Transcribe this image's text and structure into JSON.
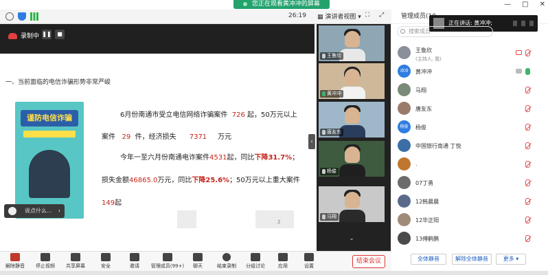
{
  "window": {
    "share_banner": "您正在观看黄冲冲的屏幕",
    "controls": [
      "—",
      "□",
      "✕"
    ]
  },
  "toolbar": {
    "time": "26:19",
    "view_mode": "演讲者视图",
    "members_header": "管理成员(10"
  },
  "recording": {
    "label": "录制中",
    "pause": "❚❚",
    "stop": "■"
  },
  "slide": {
    "section_title": "一、当前面临的电信诈骗形势非常严峻",
    "poster_title": "谨防电信诈骗",
    "line1_a": "6月份南通市受立电信网络诈骗案件",
    "line1_b": "726",
    "line1_c": "起，50万元以上",
    "line2_a": "案件",
    "line2_b": "29",
    "line2_c": "件，经济损失",
    "line2_d": "7371",
    "line2_e": "万元",
    "line3_a": "今年一至六月份南通电诈案件",
    "line3_b": "4531",
    "line3_c": "起，同比",
    "line3_d": "下降31.7%",
    "line3_e": "；",
    "line4_a": "损失金额",
    "line4_b": "46865.0",
    "line4_c": "万元，同比",
    "line4_d": "下降25.6%",
    "line4_e": "；50万元以上重大案件",
    "line5_a": "149",
    "line5_b": "起",
    "page_number": "2"
  },
  "chat_input": {
    "placeholder": "说点什么..."
  },
  "video_tiles": [
    {
      "name": "王鲁欣"
    },
    {
      "name": "黄冲冲"
    },
    {
      "name": "唐友东"
    },
    {
      "name": "杨俊"
    },
    {
      "name": "马翔"
    }
  ],
  "speaker_toast": "正在讲话: 黄冲冲;",
  "search": {
    "placeholder": "搜索成员"
  },
  "members": [
    {
      "name": "王鲁欣",
      "sub": "(主持人, 我)",
      "avatar": "",
      "avatar_color": "#8a8f99"
    },
    {
      "name": "黄冲冲",
      "sub": "",
      "avatar": "冲冲",
      "avatar_color": "#2f7de1"
    },
    {
      "name": "马翔",
      "sub": "",
      "avatar": "",
      "avatar_color": "#7a8a78"
    },
    {
      "name": "唐友东",
      "sub": "",
      "avatar": "",
      "avatar_color": "#9a7b6a"
    },
    {
      "name": "杨俊",
      "sub": "",
      "avatar": "杨俊",
      "avatar_color": "#2f7de1"
    },
    {
      "name": "中国银行南通 丁悦",
      "sub": "",
      "avatar": "",
      "avatar_color": "#3a6ea5"
    },
    {
      "name": ".",
      "sub": "",
      "avatar": "",
      "avatar_color": "#c0762f"
    },
    {
      "name": "07丁勇",
      "sub": "",
      "avatar": "",
      "avatar_color": "#6c6c6c"
    },
    {
      "name": "12韩晨晨",
      "sub": "",
      "avatar": "",
      "avatar_color": "#5a6a8a"
    },
    {
      "name": "12华正阳",
      "sub": "",
      "avatar": "",
      "avatar_color": "#a08a78"
    },
    {
      "name": "13傅鹤鹏",
      "sub": "",
      "avatar": "",
      "avatar_color": "#4a4a4a"
    }
  ],
  "member_actions": {
    "mute_all": "全体静音",
    "unmute_all": "解除全体静音",
    "more": "更多 ▾"
  },
  "bottom_bar": [
    {
      "label": "解除静音"
    },
    {
      "label": "停止视频"
    },
    {
      "label": "共享屏幕"
    },
    {
      "label": "安全"
    },
    {
      "label": "邀请"
    },
    {
      "label": "管理成员(99+)"
    },
    {
      "label": "聊天"
    },
    {
      "label": "结束录制"
    },
    {
      "label": "分组讨论"
    },
    {
      "label": "应用"
    },
    {
      "label": "设置"
    }
  ],
  "end_meeting": "结束会议"
}
